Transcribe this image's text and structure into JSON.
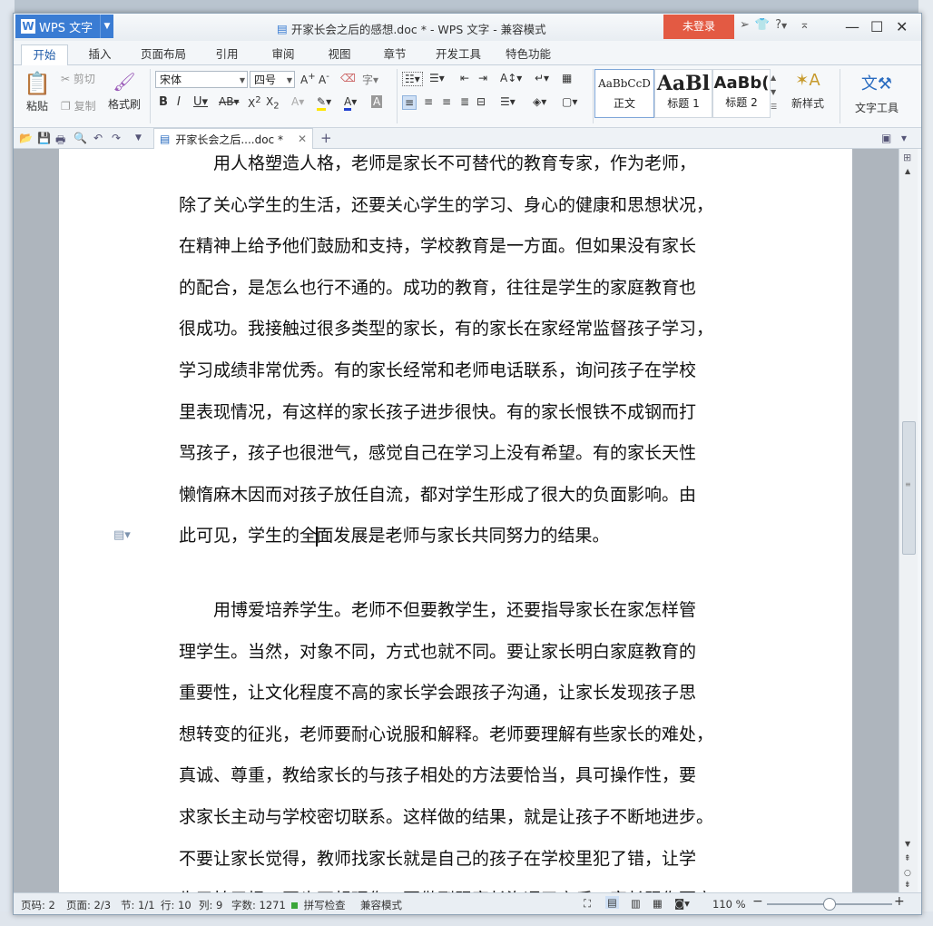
{
  "app": {
    "name": "WPS 文字",
    "logo_letter": "W"
  },
  "window": {
    "title": "开家长会之后的感想.doc * - WPS 文字 - 兼容模式",
    "login_label": "未登录",
    "help_label": "?",
    "title_icons": [
      "paper-plane-icon",
      "shirt-icon",
      "help-icon",
      "collapse-ribbon-icon"
    ],
    "controls": [
      "minimize-icon",
      "maximize-icon",
      "close-icon"
    ]
  },
  "tabs": [
    "开始",
    "插入",
    "页面布局",
    "引用",
    "审阅",
    "视图",
    "章节",
    "开发工具",
    "特色功能"
  ],
  "active_tab": "开始",
  "ribbon": {
    "clipboard": {
      "paste": "粘贴",
      "cut": "剪切",
      "copy": "复制",
      "format_painter": "格式刷"
    },
    "font_name": "宋体",
    "font_size": "四号",
    "styles": [
      {
        "preview": "AaBbCcD",
        "label": "正文"
      },
      {
        "preview": "AaBl",
        "label": "标题 1"
      },
      {
        "preview": "AaBb(",
        "label": "标题 2"
      }
    ],
    "new_style": "新样式",
    "text_tools": "文字工具"
  },
  "document": {
    "tab_label": "开家长会之后....doc *",
    "paragraphs": [
      {
        "lines": [
          "用人格塑造人格，老师是家长不可替代的教育专家，作为老师，",
          "除了关心学生的生活，还要关心学生的学习、身心的健康和思想状况，",
          "在精神上给予他们鼓励和支持，学校教育是一方面。但如果没有家长",
          "的配合，是怎么也行不通的。成功的教育，往往是学生的家庭教育也",
          "很成功。我接触过很多类型的家长，有的家长在家经常监督孩子学习，",
          "学习成绩非常优秀。有的家长经常和老师电话联系，询问孩子在学校",
          "里表现情况，有这样的家长孩子进步很快。有的家长恨铁不成钢而打",
          "骂孩子，孩子也很泄气，感觉自己在学习上没有希望。有的家长天性",
          "懒惰麻木因而对孩子放任自流，都对学生形成了很大的负面影响。由"
        ],
        "last_line_before_cursor": "此可见，学生的全",
        "last_line_after_cursor": "面发展是老师与家长共同努力的结果。"
      },
      {
        "lines": [
          "用博爱培养学生。老师不但要教学生，还要指导家长在家怎样管",
          "理学生。当然，对象不同，方式也就不同。要让家长明白家庭教育的",
          "重要性，让文化程度不高的家长学会跟孩子沟通，让家长发现孩子思",
          "想转变的征兆，老师要耐心说服和解释。老师要理解有些家长的难处，",
          "真诚、尊重，教给家长的与孩子相处的方法要恰当，具可操作性，要",
          "求家长主动与学校密切联系。这样做的结果，就是让孩子不断地进步。",
          "不要让家长觉得，教师找家长就是自己的孩子在学校里犯了错，让学",
          "生又怕又恨，再也不想理你。要做到跟家长沟通了之后，家长跟你更亲"
        ]
      }
    ]
  },
  "status": {
    "page_num": "页码: 2",
    "pages": "页面: 2/3",
    "section": "节: 1/1",
    "row": "行: 10",
    "col": "列: 9",
    "word_count": "字数: 1271",
    "spell_check": "拼写检查",
    "mode": "兼容模式",
    "zoom": "110 %"
  },
  "colors": {
    "brand": "#3a7cd3",
    "login": "#e35a43",
    "active_tab_text": "#1e5aa8"
  }
}
